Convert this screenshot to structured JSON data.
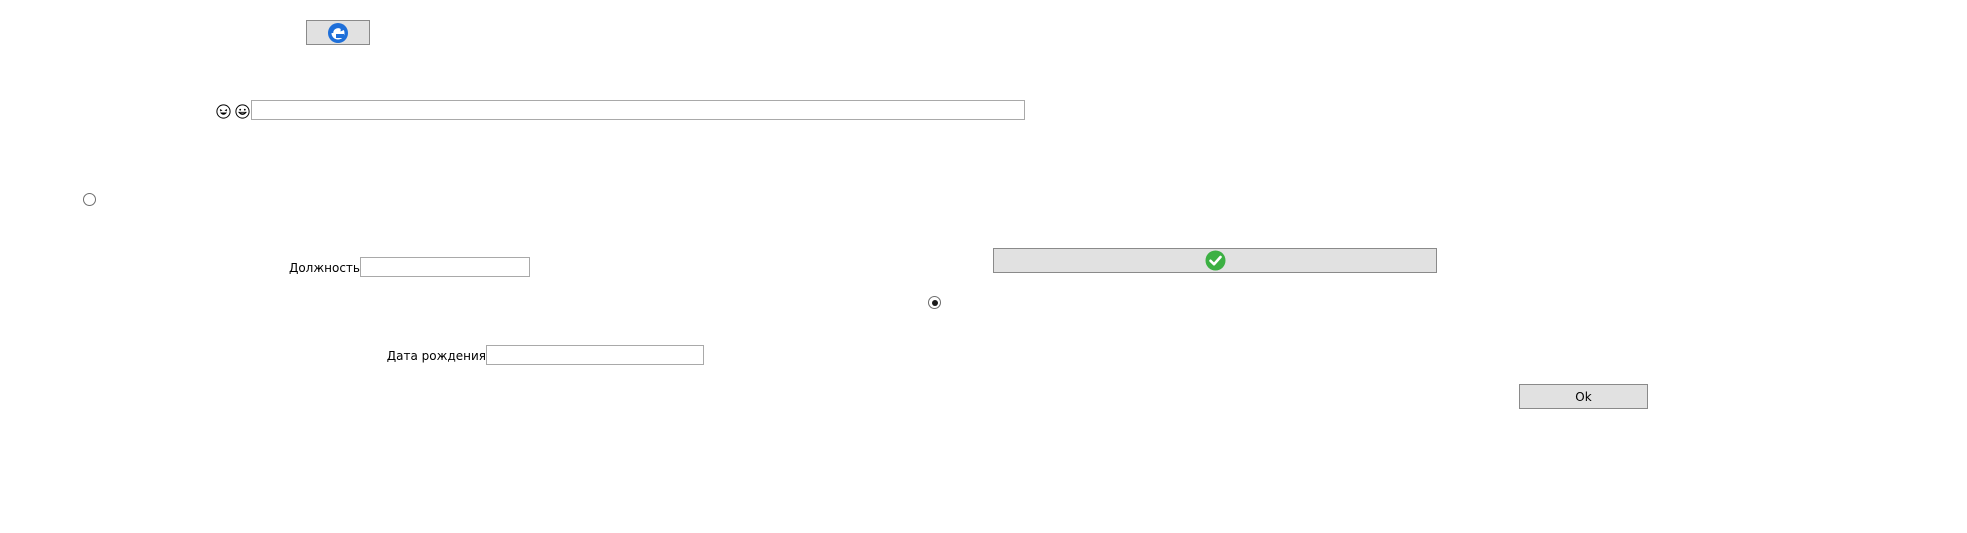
{
  "buttons": {
    "ok_label": "Ok"
  },
  "fields": {
    "position_label": "Должность",
    "position_value": "",
    "birthdate_label": "Дата рождения",
    "birthdate_value": "",
    "top_field_value": ""
  },
  "radios": {
    "left_selected": false,
    "right_selected": true
  },
  "icons": {
    "top_button": "refresh-icon",
    "confirm_button": "check-circle-icon",
    "emoji_a": "laughing-face-icon",
    "emoji_b": "grinning-face-icon"
  },
  "colors": {
    "accent_blue": "#1e6fd9",
    "confirm_green": "#3cb043",
    "button_face": "#e1e1e1"
  }
}
